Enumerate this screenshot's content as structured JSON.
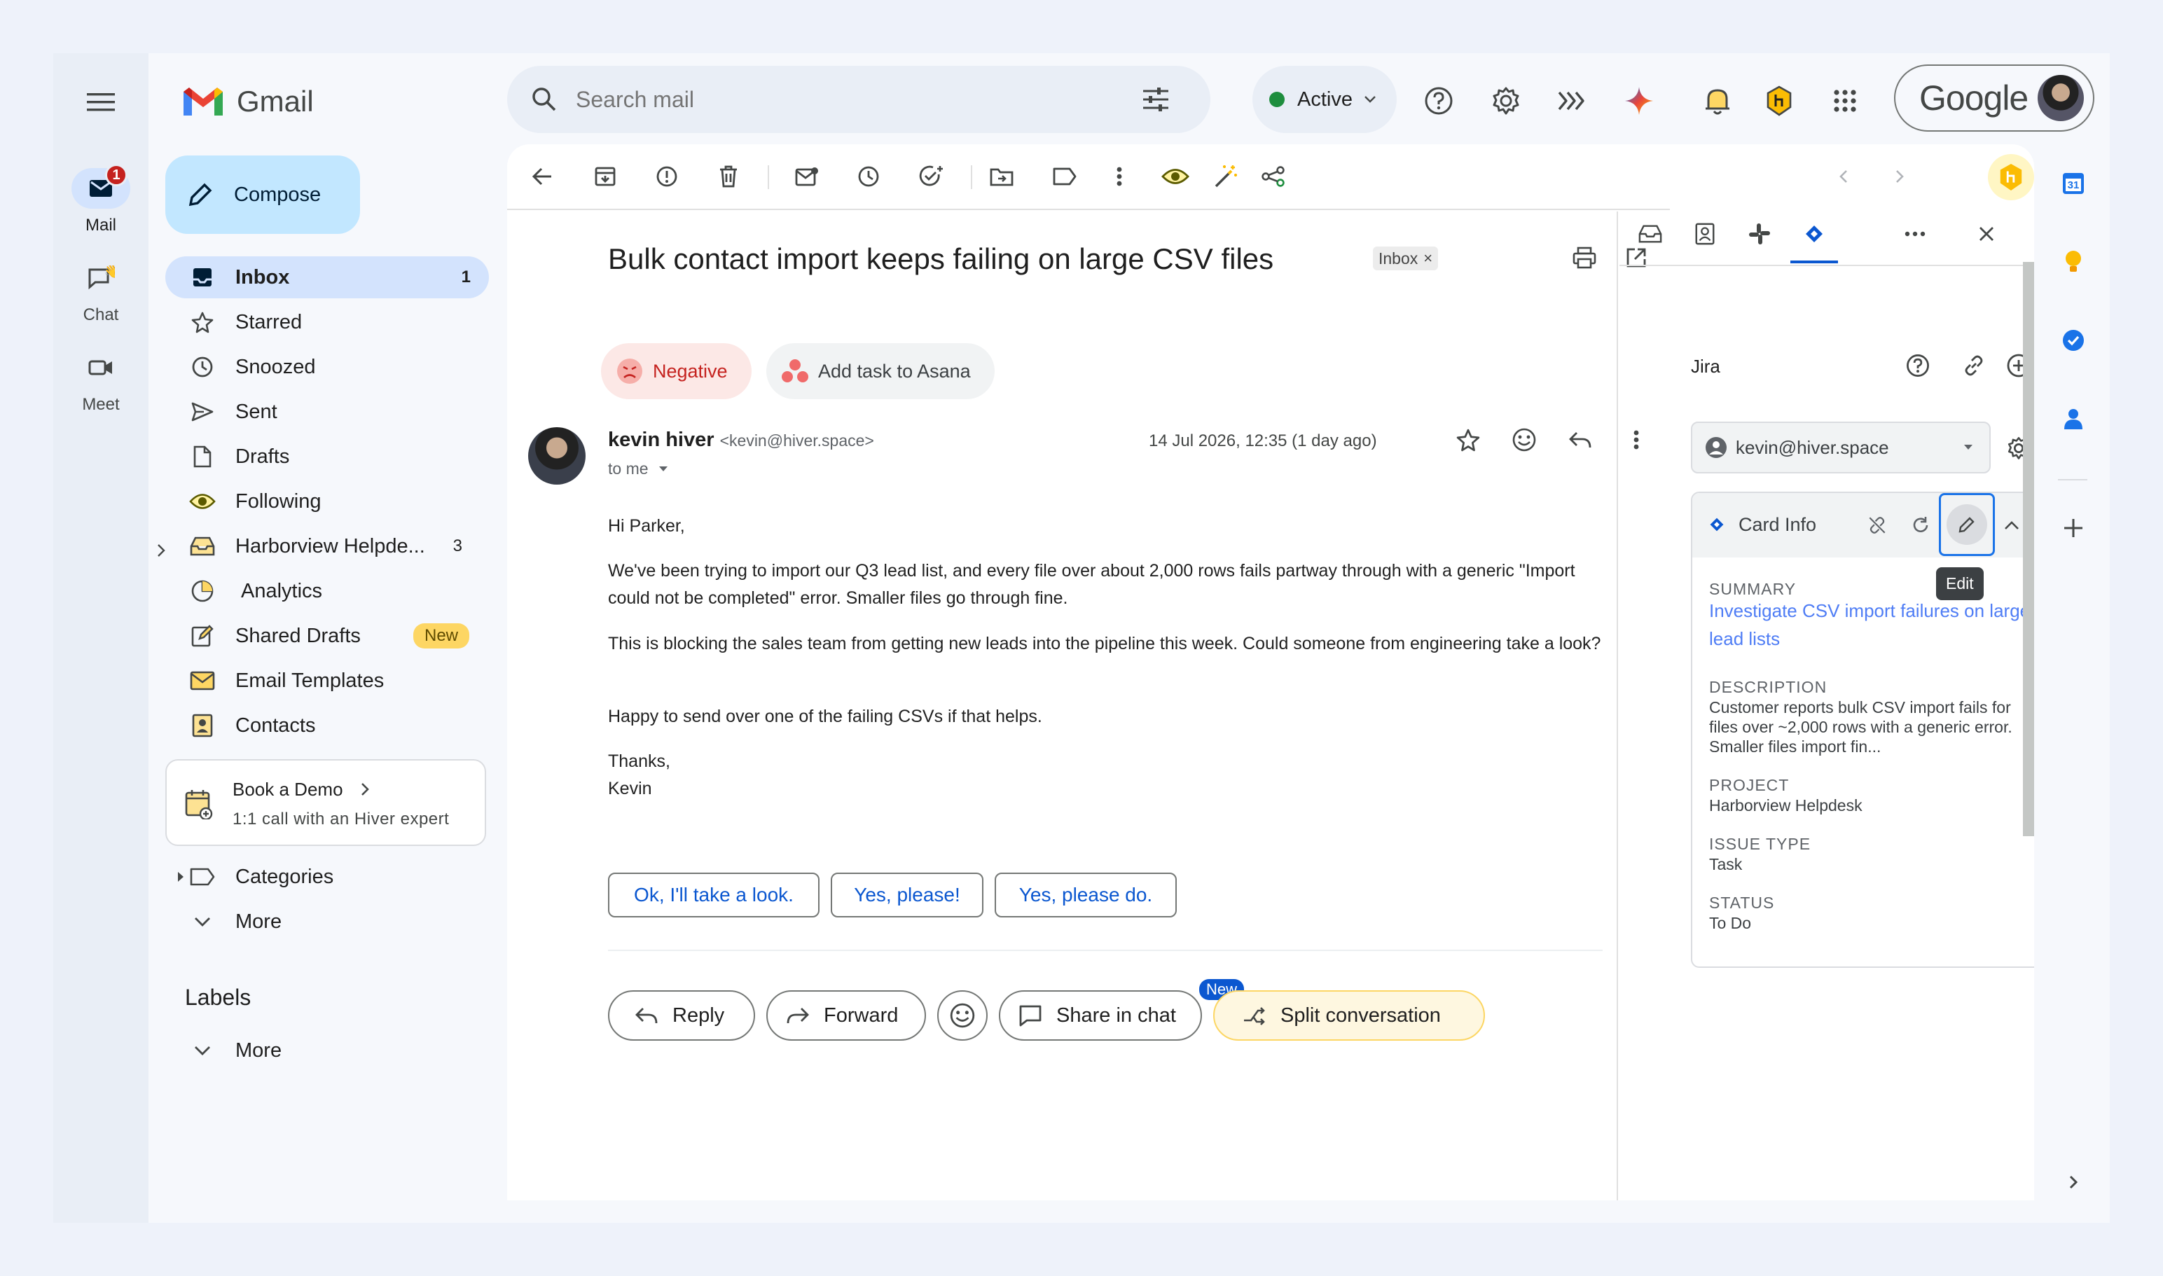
{
  "rail": {
    "mail_label": "Mail",
    "mail_badge": "1",
    "chat_label": "Chat",
    "meet_label": "Meet"
  },
  "brand": {
    "name": "Gmail"
  },
  "compose_label": "Compose",
  "nav": [
    {
      "label": "Inbox",
      "count": "1",
      "icon": "inbox-icon"
    },
    {
      "label": "Starred",
      "count": "",
      "icon": "star-icon"
    },
    {
      "label": "Snoozed",
      "count": "",
      "icon": "clock-icon"
    },
    {
      "label": "Sent",
      "count": "",
      "icon": "send-icon"
    },
    {
      "label": "Drafts",
      "count": "",
      "icon": "draft-icon"
    },
    {
      "label": "Following",
      "count": "",
      "icon": "eye-icon"
    },
    {
      "label": "Harborview Helpde...",
      "count": "3",
      "icon": "shared-inbox-icon"
    },
    {
      "label": "Analytics",
      "count": "",
      "icon": "pie-chart-icon"
    },
    {
      "label": "Shared Drafts",
      "badge": "New",
      "icon": "shared-draft-icon"
    },
    {
      "label": "Email Templates",
      "count": "",
      "icon": "template-icon"
    },
    {
      "label": "Contacts",
      "count": "",
      "icon": "contacts-icon"
    }
  ],
  "demo": {
    "title": "Book a Demo",
    "subtitle": "1:1 call with an Hiver expert"
  },
  "categories_label": "Categories",
  "more_label": "More",
  "labels_heading": "Labels",
  "labels_more": "More",
  "search": {
    "placeholder": "Search mail"
  },
  "status": {
    "label": "Active",
    "color": "#1e8e3e"
  },
  "account": {
    "logo": "Google"
  },
  "email": {
    "subject": "Bulk contact import keeps failing on large CSV files",
    "label_chip": "Inbox",
    "sentiment": "Negative",
    "asana": "Add task to Asana",
    "sender_name": "kevin hiver",
    "sender_email": "<kevin@hiver.space>",
    "to": "to me",
    "date": "14 Jul 2026, 12:35 (1 day ago)",
    "body": [
      "Hi Parker,",
      "We've been trying to import our Q3 lead list, and every file over about 2,000 rows fails partway through with a generic \"Import could not be completed\" error. Smaller files go through fine.",
      "This is blocking the sales team from getting new leads into the pipeline this week. Could someone from engineering take a look?",
      "Happy to send over one of the failing CSVs if that helps.",
      "Thanks,",
      "Kevin"
    ],
    "smart_replies": [
      "Ok, I'll take a look.",
      "Yes, please!",
      "Yes, please do."
    ],
    "actions": {
      "reply": "Reply",
      "forward": "Forward",
      "share_chat": "Share in chat",
      "share_badge": "New",
      "split": "Split conversation"
    }
  },
  "jira": {
    "title": "Jira",
    "account": "kevin@hiver.space",
    "card_title": "Card Info",
    "tooltip": "Edit",
    "summary_label": "SUMMARY",
    "summary": "Investigate CSV import failures on large lead lists",
    "description_label": "DESCRIPTION",
    "description": "Customer reports bulk CSV import fails for files over ~2,000 rows with a generic error. Smaller files import fin...",
    "project_label": "PROJECT",
    "project": "Harborview Helpdesk",
    "issue_type_label": "ISSUE TYPE",
    "issue_type": "Task",
    "status_label": "STATUS",
    "status": "To Do"
  },
  "side_apps": {
    "calendar_day": "31"
  },
  "colors": {
    "accent_blue": "#0b57d0",
    "compose_bg": "#c2e7ff",
    "active_nav": "#d3e3fd",
    "negative_bg": "#fce8e6",
    "split_bg": "#fef7e0",
    "hiver_yellow": "#fbbc04"
  }
}
